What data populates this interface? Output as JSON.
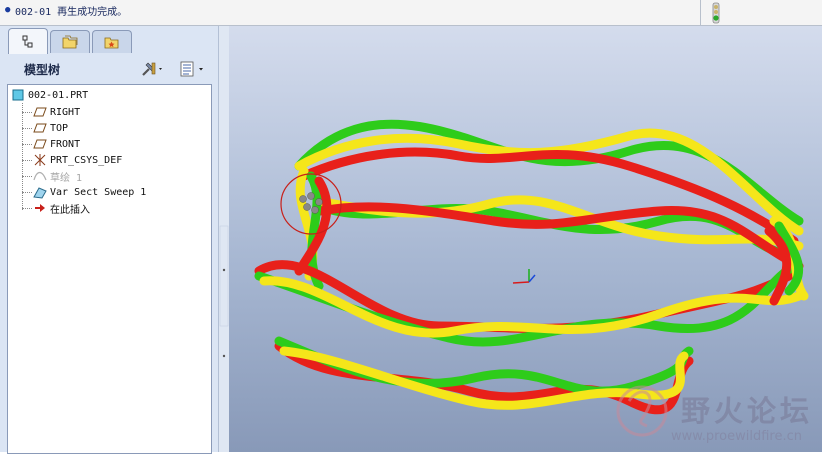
{
  "message_bar": {
    "text": "002-01 再生成功完成。"
  },
  "model_tree": {
    "title": "模型树",
    "items": [
      {
        "label": "002-01.PRT",
        "icon": "part-icon",
        "enabled": true
      },
      {
        "label": "RIGHT",
        "icon": "datum-plane-icon",
        "enabled": true
      },
      {
        "label": "TOP",
        "icon": "datum-plane-icon",
        "enabled": true
      },
      {
        "label": "FRONT",
        "icon": "datum-plane-icon",
        "enabled": true
      },
      {
        "label": "PRT_CSYS_DEF",
        "icon": "coordinate-system-icon",
        "enabled": true
      },
      {
        "label": "草绘 1",
        "icon": "sketch-icon",
        "enabled": false
      },
      {
        "label": "Var Sect Sweep 1",
        "icon": "sweep-icon",
        "enabled": true
      },
      {
        "label": "在此插入",
        "icon": "insert-here-arrow-icon",
        "enabled": true
      }
    ]
  },
  "watermark": {
    "text": "野火论坛",
    "url": "www.proewildfire.cn"
  },
  "colors": {
    "strand_red": "#e8201a",
    "strand_green": "#2ecc1a",
    "strand_yellow": "#f5e61a",
    "status_green": "#2aa82a"
  }
}
